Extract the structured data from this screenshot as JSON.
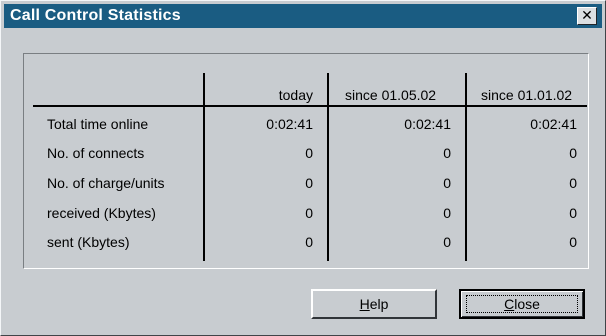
{
  "window": {
    "title": "Call Control Statistics",
    "close_glyph": "✕",
    "accent": "#1a5c82"
  },
  "table": {
    "columns": [
      "today",
      "since 01.05.02",
      "since 01.01.02"
    ],
    "rows": [
      {
        "label": "Total time online",
        "values": [
          "0:02:41",
          "0:02:41",
          "0:02:41"
        ]
      },
      {
        "label": "No. of connects",
        "values": [
          "0",
          "0",
          "0"
        ]
      },
      {
        "label": "No. of charge/units",
        "values": [
          "0",
          "0",
          "0"
        ]
      },
      {
        "label": "received (Kbytes)",
        "values": [
          "0",
          "0",
          "0"
        ]
      },
      {
        "label": "sent (Kbytes)",
        "values": [
          "0",
          "0",
          "0"
        ]
      }
    ]
  },
  "buttons": {
    "help": {
      "mnemonic": "H",
      "rest": "elp"
    },
    "close": {
      "mnemonic": "C",
      "rest": "lose"
    }
  }
}
